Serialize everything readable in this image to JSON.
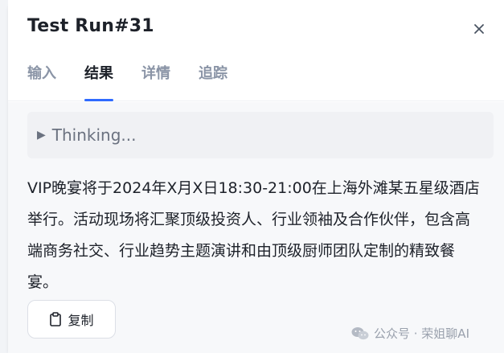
{
  "header": {
    "title": "Test Run#31",
    "close_icon": "close-icon"
  },
  "tabs": [
    {
      "label": "输入",
      "active": false
    },
    {
      "label": "结果",
      "active": true
    },
    {
      "label": "详情",
      "active": false
    },
    {
      "label": "追踪",
      "active": false
    }
  ],
  "thinking": {
    "label": "Thinking...",
    "icon": "triangle-right-icon"
  },
  "result": {
    "text": "VIP晚宴将于2024年X月X日18:30-21:00在上海外滩某五星级酒店举行。活动现场将汇聚顶级投资人、行业领袖及合作伙伴，包含高端商务社交、行业趋势主题演讲和由顶级厨师团队定制的精致餐宴。"
  },
  "copy_button": {
    "label": "复制",
    "icon": "clipboard-icon"
  },
  "watermark": {
    "text": "公众号 · 荣姐聊AI",
    "icon": "wechat-icon"
  },
  "colors": {
    "accent": "#2f6bff",
    "text": "#1d2129",
    "muted": "#8a94a6",
    "background": "#f7f8fa"
  }
}
